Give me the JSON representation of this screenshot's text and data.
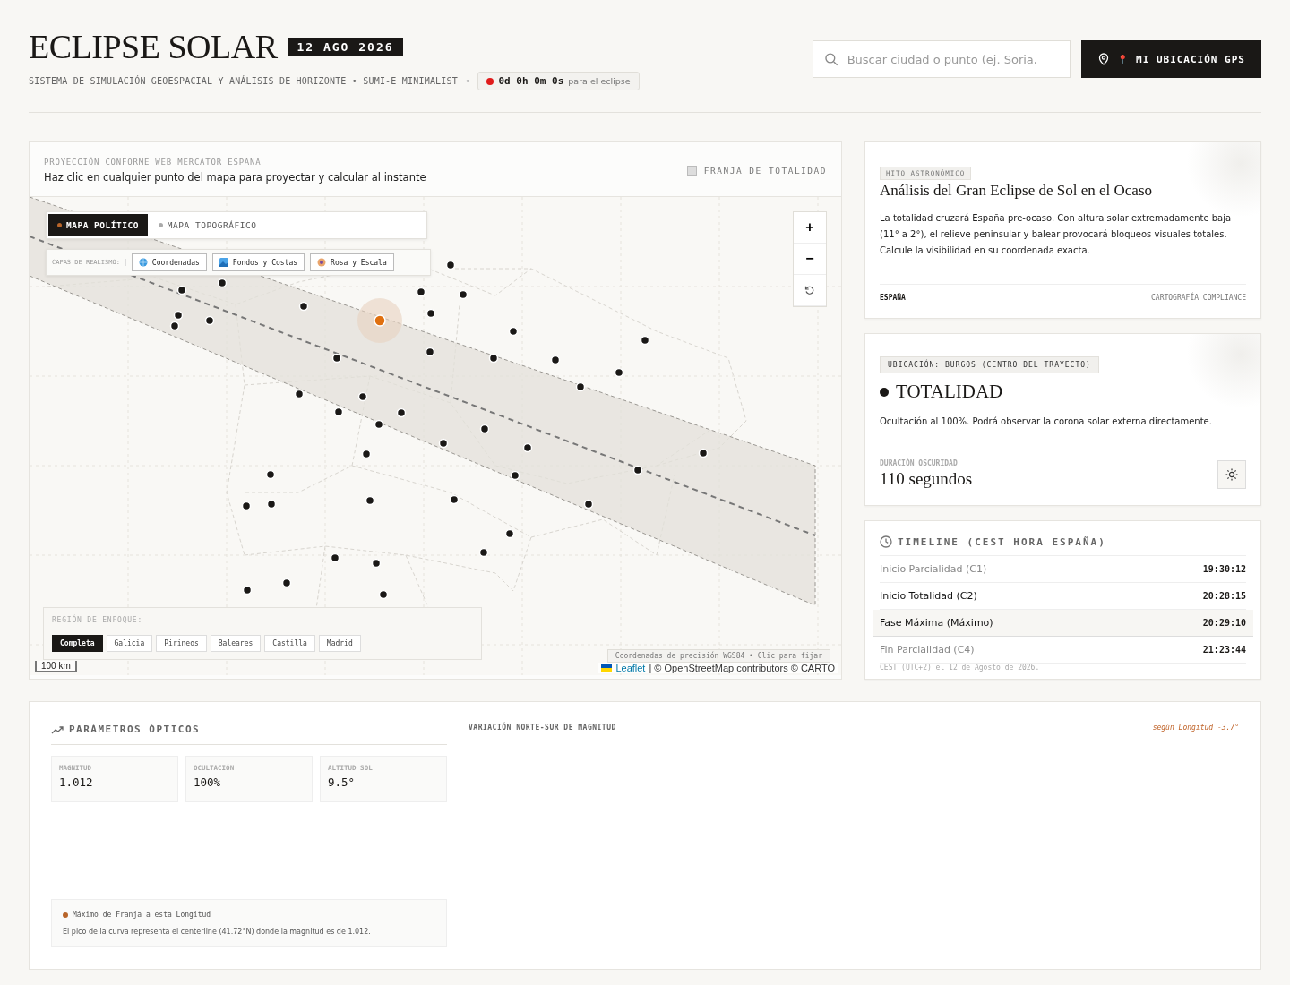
{
  "header": {
    "title": "ECLIPSE SOLAR",
    "date_badge": "12 AGO 2026",
    "subtitle": "SISTEMA DE SIMULACIÓN GEOESPACIAL Y ANÁLISIS DE HORIZONTE • SUMI-E MINIMALIST",
    "separator": "•",
    "countdown": {
      "value": "0d 0h 0m 0s",
      "suffix": "para el eclipse"
    },
    "search": {
      "placeholder": "Buscar ciudad o punto (ej. Soria,"
    },
    "gps_button": {
      "pin": "📍",
      "label": "MI UBICACIÓN GPS"
    }
  },
  "map_panel": {
    "projection": "PROYECCIÓN CONFORME WEB MERCATOR ESPAÑA",
    "instruction": "Haz clic en cualquier punto del mapa para proyectar y calcular al instante",
    "legend": "FRANJA DE TOTALIDAD",
    "map_tabs": [
      {
        "label": "MAPA POLÍTICO",
        "selected": true
      },
      {
        "label": "MAPA TOPOGRÁFICO",
        "selected": false
      }
    ],
    "layers_label": "CAPAS DE REALISMO:",
    "layers": [
      {
        "label": "Coordenadas",
        "kind": "globe"
      },
      {
        "label": "Fondos y Costas",
        "kind": "landscape"
      },
      {
        "label": "Rosa y Escala",
        "kind": "compass"
      }
    ],
    "zoom_in": "+",
    "zoom_out": "−",
    "region_label": "REGIÓN DE ENFOQUE:",
    "regions": [
      {
        "label": "Completa",
        "selected": true
      },
      {
        "label": "Galicia",
        "selected": false
      },
      {
        "label": "Pirineos",
        "selected": false
      },
      {
        "label": "Baleares",
        "selected": false
      },
      {
        "label": "Castilla",
        "selected": false
      },
      {
        "label": "Madrid",
        "selected": false
      }
    ],
    "scale": "100 km",
    "coords_tip": "Coordenadas de precisión WGS84 • Clic para fijar",
    "attribution": {
      "link": "Leaflet",
      "text": "| © OpenStreetMap contributors © CARTO"
    }
  },
  "milestone": {
    "tag": "HITO ASTRONÓMICO",
    "title": "Análisis del Gran Eclipse de Sol en el Ocaso",
    "body": "La totalidad cruzará España pre-ocaso. Con altura solar extremadamente baja (11° a 2°), el relieve peninsular y balear provocará bloqueos visuales totales. Calcule la visibilidad en su coordenada exacta.",
    "footer_left": "ESPAÑA",
    "footer_right": "CARTOGRAFÍA COMPLIANCE"
  },
  "location": {
    "tag": "UBICACIÓN: BURGOS (CENTRO DEL TRAYECTO)",
    "status": "TOTALIDAD",
    "description": "Ocultación al 100%. Podrá observar la corona solar externa directamente.",
    "duration_label": "DURACIÓN OSCURIDAD",
    "duration": "110 segundos"
  },
  "timeline": {
    "title": "TIMELINE (CEST HORA ESPAÑA)",
    "rows": [
      {
        "label": "Inicio Parcialidad (C1)",
        "time": "19:30:12",
        "kind": "partial",
        "selected": false
      },
      {
        "label": "Inicio Totalidad (C2)",
        "time": "20:28:15",
        "kind": "total",
        "selected": false
      },
      {
        "label": "Fase Máxima (Máximo)",
        "time": "20:29:10",
        "kind": "total",
        "selected": true
      },
      {
        "label": "Fin Parcialidad (C4)",
        "time": "21:23:44",
        "kind": "partial",
        "selected": false
      }
    ],
    "note": "CEST (UTC+2) el 12 de Agosto de 2026."
  },
  "optics": {
    "title": "PARÁMETROS ÓPTICOS",
    "stats": [
      {
        "label": "MAGNITUD",
        "value": "1.012"
      },
      {
        "label": "OCULTACIÓN",
        "value": "100%"
      },
      {
        "label": "ALTITUD SOL",
        "value": "9.5°"
      }
    ],
    "info_title": "Máximo de Franja a esta Longitud",
    "info_text": "El pico de la curva representa el centerline (41.72°N) donde la magnitud es de 1.012.",
    "chart_title": "VARIACIÓN NORTE-SUR DE MAGNITUD",
    "chart_note": "según Longitud -3.7°"
  }
}
